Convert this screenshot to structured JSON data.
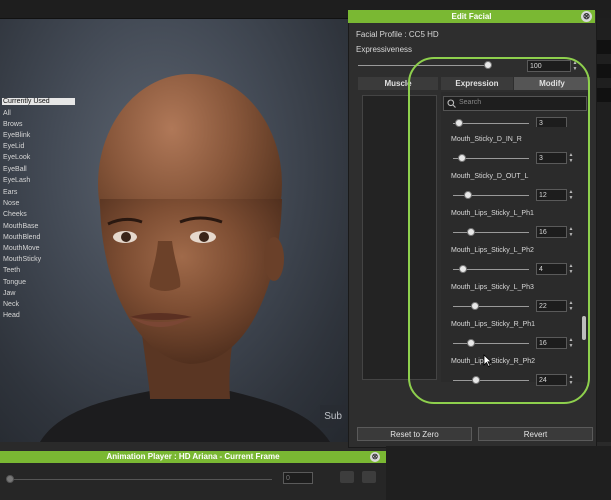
{
  "app": {
    "sub_label": "Sub"
  },
  "panel": {
    "title": "Edit Facial",
    "close_symbol": "⊗",
    "facial_profile": "Facial Profile : CC5 HD",
    "expressiveness_label": "Expressiveness",
    "expressiveness_value": "100",
    "expressiveness_fraction": 1.0,
    "tabs": [
      {
        "label": "Muscle"
      },
      {
        "label": "Expression"
      },
      {
        "label": "Modify"
      }
    ],
    "muscle_list": [
      "Currently Used",
      "All",
      "Brows",
      "EyeBlink",
      "EyeLid",
      "EyeLook",
      "EyeBall",
      "EyeLash",
      "Ears",
      "Nose",
      "Cheeks",
      "MouthBase",
      "MouthBlend",
      "MouthMove",
      "MouthSticky",
      "Teeth",
      "Tongue",
      "Jaw",
      "Neck",
      "Head"
    ],
    "search_placeholder": "Search",
    "partial_value": "3",
    "sliders": [
      {
        "label": "Mouth_Sticky_D_IN_R",
        "value": "3",
        "fraction": 0.03
      },
      {
        "label": "Mouth_Sticky_D_OUT_L",
        "value": "12",
        "fraction": 0.12
      },
      {
        "label": "Mouth_Lips_Sticky_L_Ph1",
        "value": "16",
        "fraction": 0.16
      },
      {
        "label": "Mouth_Lips_Sticky_L_Ph2",
        "value": "4",
        "fraction": 0.04
      },
      {
        "label": "Mouth_Lips_Sticky_L_Ph3",
        "value": "22",
        "fraction": 0.22
      },
      {
        "label": "Mouth_Lips_Sticky_R_Ph1",
        "value": "16",
        "fraction": 0.16
      },
      {
        "label": "Mouth_Lips_Sticky_R_Ph2",
        "value": "24",
        "fraction": 0.24
      }
    ],
    "reset_button": "Reset to Zero",
    "revert_button": "Revert"
  },
  "animation_player": {
    "title": "Animation Player : HD Ariana - Current Frame",
    "close_symbol": "⊗",
    "frame_value": "0"
  },
  "colors": {
    "accent": "#7ab833",
    "highlight": "#8ed04d"
  }
}
